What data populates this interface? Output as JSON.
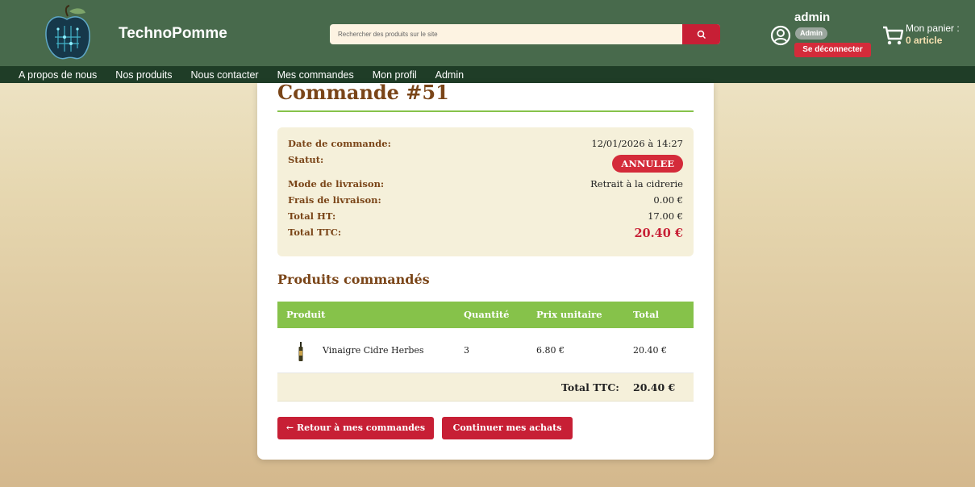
{
  "header": {
    "brand": "TechnoPomme",
    "search_placeholder": "Rechercher des produits sur le site",
    "user": {
      "name": "admin",
      "role": "Admin",
      "logout_label": "Se déconnecter"
    },
    "cart": {
      "label": "Mon panier :",
      "count": "0 article"
    }
  },
  "nav": {
    "items": [
      "A propos de nous",
      "Nos produits",
      "Nous contacter",
      "Mes commandes",
      "Mon profil",
      "Admin"
    ]
  },
  "order": {
    "title": "Commande #51",
    "date_label": "Date de commande:",
    "date_value": "12/01/2026 à 14:27",
    "status_label": "Statut:",
    "status_value": "ANNULEE",
    "delivery_label": "Mode de livraison:",
    "delivery_value": "Retrait à la cidrerie",
    "fees_label": "Frais de livraison:",
    "fees_value": "0.00 €",
    "total_ht_label": "Total HT:",
    "total_ht_value": "17.00 €",
    "total_ttc_label": "Total TTC:",
    "total_ttc_value": "20.40 €"
  },
  "products": {
    "section_title": "Produits commandés",
    "columns": [
      "Produit",
      "Quantité",
      "Prix unitaire",
      "Total"
    ],
    "rows": [
      {
        "name": "Vinaigre Cidre Herbes",
        "quantity": "3",
        "unit_price": "6.80 €",
        "total": "20.40 €"
      }
    ],
    "total_label": "Total TTC:",
    "total_value": "20.40 €"
  },
  "actions": {
    "back_label": "← Retour à mes commandes",
    "continue_label": "Continuer mes achats"
  },
  "colors": {
    "header_bg": "#486a4c",
    "nav_bg": "#1f3d27",
    "accent_red": "#c71f35",
    "accent_green": "#86c24a",
    "title_brown": "#7a4518"
  }
}
